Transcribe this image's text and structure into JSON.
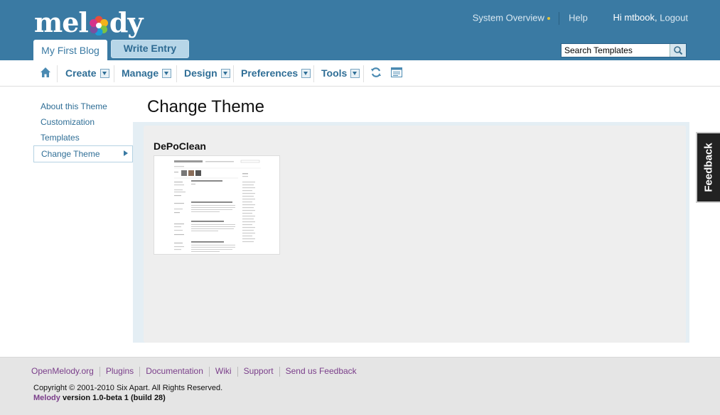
{
  "header": {
    "logo_text_left": "mel",
    "logo_text_right": "dy",
    "top_links": {
      "system_overview": "System Overview",
      "help": "Help",
      "greeting": "Hi mtbook,",
      "logout": "Logout"
    },
    "blog_tab": "My First Blog",
    "write_entry": "Write Entry",
    "search": {
      "value": "Search Templates"
    }
  },
  "nav": {
    "items": [
      {
        "label": "Create"
      },
      {
        "label": "Manage"
      },
      {
        "label": "Design"
      },
      {
        "label": "Preferences"
      },
      {
        "label": "Tools"
      }
    ]
  },
  "sidebar": {
    "items": [
      {
        "label": "About this Theme"
      },
      {
        "label": "Customization"
      },
      {
        "label": "Templates"
      },
      {
        "label": "Change Theme"
      }
    ]
  },
  "main": {
    "title": "Change Theme",
    "theme_name": "DePoClean"
  },
  "feedback": {
    "label": "Feedback"
  },
  "footer": {
    "links": [
      "OpenMelody.org",
      "Plugins",
      "Documentation",
      "Wiki",
      "Support",
      "Send us Feedback"
    ],
    "copyright": "Copyright © 2001-2010 Six Apart. All Rights Reserved.",
    "version_brand": "Melody",
    "version_text": " version 1.0-beta 1 (build 28)"
  },
  "colors": {
    "header_bg": "#3a7aa3",
    "link": "#2f6e96",
    "footer_link": "#7a3e8a"
  }
}
